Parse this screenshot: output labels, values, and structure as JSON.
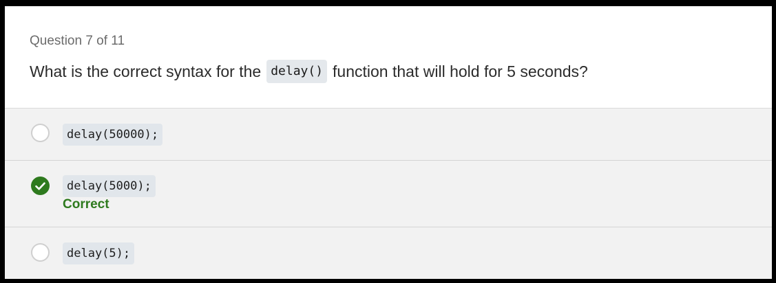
{
  "question": {
    "counter": "Question 7 of 11",
    "text_before": "What is the correct syntax for the",
    "code": "delay()",
    "text_after": "function that will hold for 5 seconds?"
  },
  "options": [
    {
      "code": "delay(50000);",
      "selected": false
    },
    {
      "code": "delay(5000);",
      "selected": true,
      "feedback": "Correct"
    },
    {
      "code": "delay(5);",
      "selected": false
    }
  ],
  "icons": {
    "selected": "check-icon",
    "unselected": "radio-empty-icon"
  },
  "colors": {
    "correct": "#2e7a1e",
    "code_background": "#e1e6eb",
    "option_background": "#f2f2f2"
  }
}
